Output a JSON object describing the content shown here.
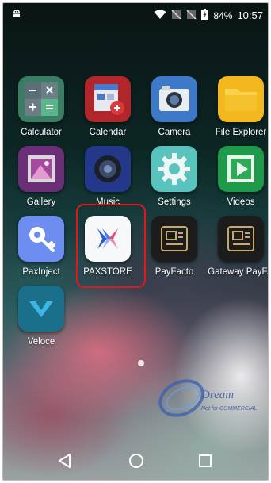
{
  "status": {
    "battery_percent": "84%",
    "time": "10:57",
    "icons": [
      "android-debug-icon",
      "wifi-icon",
      "no-sim-icon",
      "no-sim-icon",
      "battery-charging-icon"
    ]
  },
  "apps": [
    {
      "label": "Calculator",
      "icon": "calculator-icon"
    },
    {
      "label": "Calendar",
      "icon": "calendar-icon"
    },
    {
      "label": "Camera",
      "icon": "camera-icon"
    },
    {
      "label": "File Explorer",
      "icon": "folder-icon"
    },
    {
      "label": "Gallery",
      "icon": "gallery-icon"
    },
    {
      "label": "Music",
      "icon": "music-speaker-icon"
    },
    {
      "label": "Settings",
      "icon": "gear-icon"
    },
    {
      "label": "Videos",
      "icon": "play-icon"
    },
    {
      "label": "PaxInject",
      "icon": "key-icon"
    },
    {
      "label": "PAXSTORE",
      "icon": "paxstore-logo-icon"
    },
    {
      "label": "PayFacto",
      "icon": "terminal-card-icon"
    },
    {
      "label": "Gateway PayF...",
      "icon": "terminal-card-icon"
    },
    {
      "label": "Veloce",
      "icon": "veloce-v-icon"
    }
  ],
  "navigation": [
    "back-icon",
    "home-icon",
    "recents-icon"
  ],
  "watermark": {
    "line1": "Dream",
    "line2": "Not for COMMERCIAL"
  },
  "colors": {
    "highlight": "#e0181c"
  }
}
